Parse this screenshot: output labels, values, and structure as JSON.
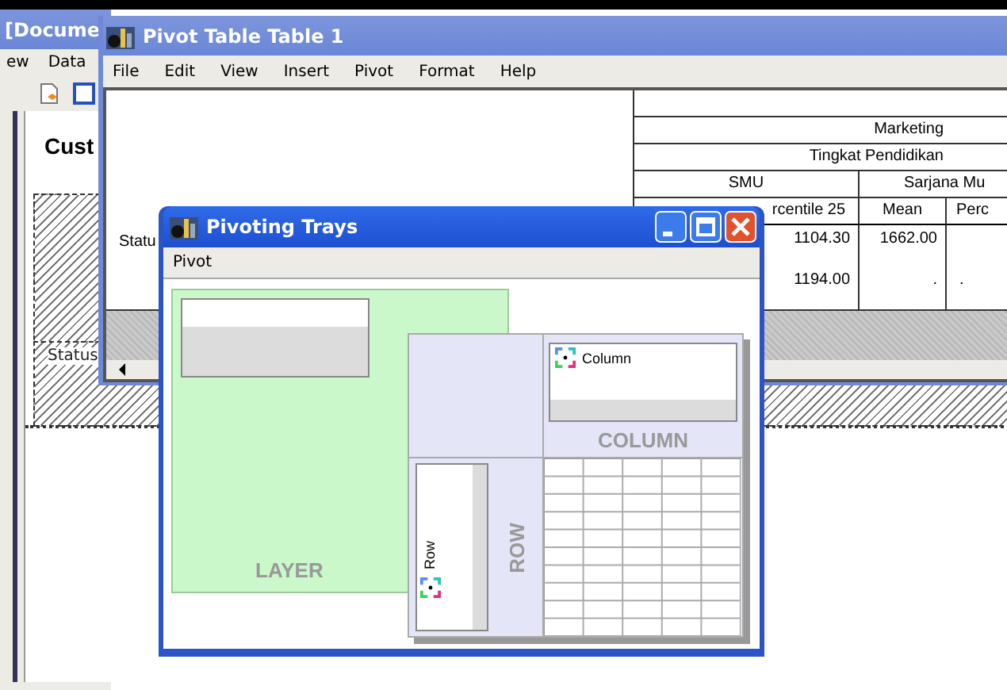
{
  "back_window": {
    "title": "[Docume",
    "menu": [
      "ew",
      "Data"
    ],
    "heading": "Cust",
    "row_label": "Status"
  },
  "pivot_window": {
    "title": "Pivot Table Table 1",
    "menu": [
      "File",
      "Edit",
      "View",
      "Insert",
      "Pivot",
      "Format",
      "Help"
    ],
    "table": {
      "header_rows": [
        "Marketing",
        "Tingkat Pendidikan"
      ],
      "groups": [
        "SMU",
        "Sarjana Mu"
      ],
      "columns": [
        "rcentile 25",
        "Mean",
        "Perc"
      ],
      "row_label": "Statu",
      "rows": [
        [
          "1104.30",
          "1662.00"
        ],
        [
          "1194.00",
          ".",
          "."
        ]
      ]
    }
  },
  "trays_dialog": {
    "title": "Pivoting Trays",
    "menu": [
      "Pivot"
    ],
    "layer_label": "LAYER",
    "column_item": "Column",
    "column_label": "COLUMN",
    "row_item": "Row",
    "row_label": "ROW"
  }
}
